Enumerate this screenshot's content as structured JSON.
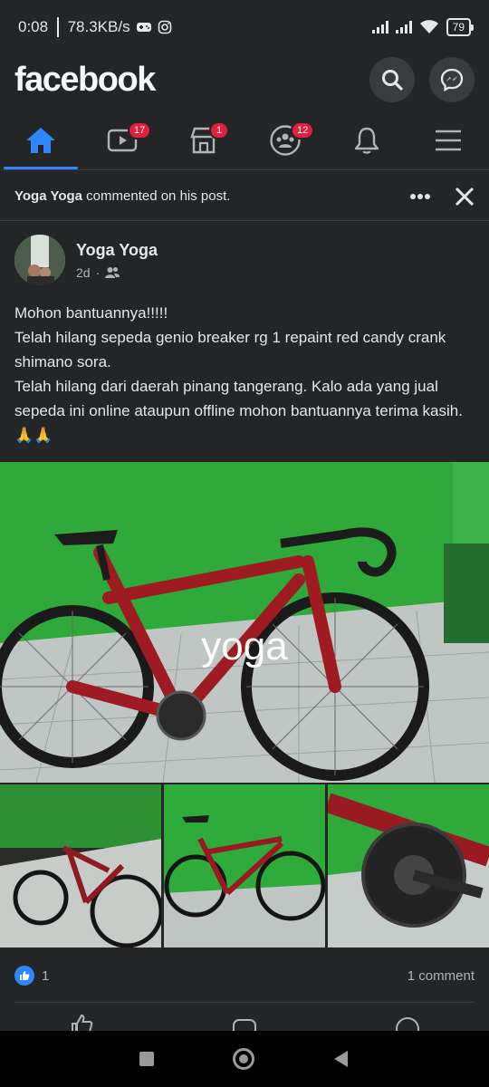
{
  "status": {
    "time": "0:08",
    "speed": "78.3KB/s",
    "battery": "79"
  },
  "app": {
    "logo": "facebook"
  },
  "nav": {
    "items": [
      {
        "name": "home",
        "badge": ""
      },
      {
        "name": "watch",
        "badge": "17"
      },
      {
        "name": "marketplace",
        "badge": "1"
      },
      {
        "name": "groups",
        "badge": "12"
      },
      {
        "name": "notifications",
        "badge": ""
      },
      {
        "name": "menu",
        "badge": ""
      }
    ]
  },
  "notification": {
    "actor": "Yoga Yoga",
    "text": " commented on his post."
  },
  "post": {
    "author": "Yoga Yoga",
    "time": "2d",
    "lines": [
      "Mohon bantuannya!!!!!",
      "Telah hilang sepeda genio breaker rg 1 repaint red candy crank shimano sora.",
      "Telah hilang dari daerah pinang tangerang. Kalo ada yang jual sepeda ini online ataupun offline mohon bantuannya terima kasih. 🙏🙏"
    ],
    "watermark": "yoga",
    "likes": "1",
    "comments": "1 comment",
    "actions": [
      "Like",
      "Comment",
      "Send"
    ]
  },
  "colors": {
    "background": "#242526",
    "accent": "#2d88ff",
    "badge": "#e41e3f"
  }
}
